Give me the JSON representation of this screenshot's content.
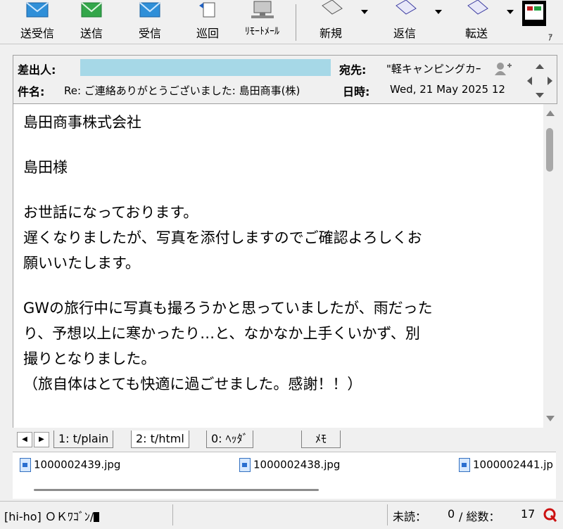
{
  "toolbar": {
    "send_receive": "送受信",
    "send": "送信",
    "receive": "受信",
    "patrol": "巡回",
    "remote_mail": "ﾘﾓｰﾄﾒｰﾙ",
    "new": "新規",
    "reply": "返信",
    "forward": "転送",
    "cut_label": "ｱ"
  },
  "header": {
    "from_label": "差出人:",
    "from_value": "",
    "to_label": "宛先:",
    "to_value": "\"軽キャンピングカｰ",
    "subject_label": "件名:",
    "subject_value": "Re: ご連絡ありがとうございました: 島田商事(株)",
    "date_label": "日時:",
    "date_value": "Wed, 21 May 2025 12"
  },
  "body": {
    "lines": [
      "島田商事株式会社",
      "島田様",
      "お世話になっております。",
      "遅くなりましたが、写真を添付しますのでご確認よろしくお",
      "願いいたします。",
      "GWの旅行中に写真も撮ろうかと思っていましたが、雨だった",
      "り、予想以上に寒かったり…と、なかなか上手くいかず、別",
      "撮りとなりました。",
      "（旅自体はとても快適に過ごせました。感謝！！）"
    ]
  },
  "tabs": {
    "items": [
      "1: t/plain",
      "2: t/html",
      "0: ﾍｯﾀﾞ",
      "ﾒﾓ"
    ]
  },
  "attachments": {
    "files": [
      "1000002439.jpg",
      "1000002438.jpg",
      "1000002441.jp"
    ]
  },
  "status": {
    "account": "[hi-ho] ＯＫﾜｺﾞﾝ/",
    "unread_label": "未読：",
    "unread_value": "0",
    "total_label": "/ 総数：",
    "total_value": "17"
  },
  "colors": {
    "from_highlight": "#a6d8e7",
    "status_q": "#cc1111"
  }
}
